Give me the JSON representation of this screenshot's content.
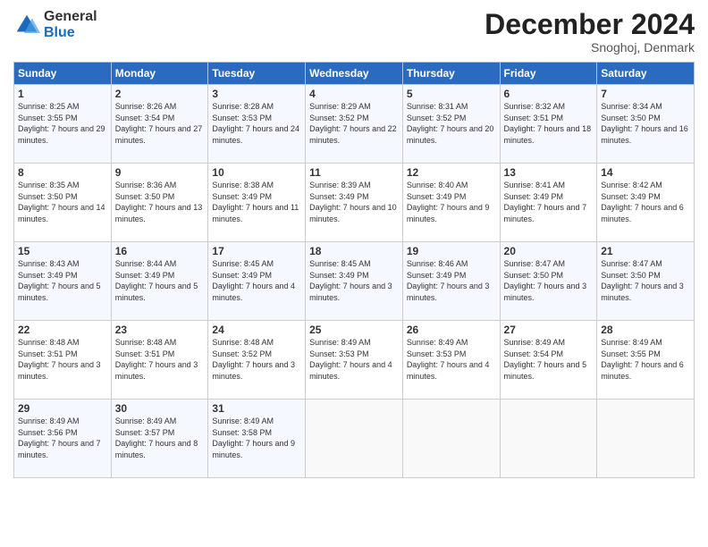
{
  "logo": {
    "general": "General",
    "blue": "Blue"
  },
  "title": "December 2024",
  "location": "Snoghoj, Denmark",
  "days_of_week": [
    "Sunday",
    "Monday",
    "Tuesday",
    "Wednesday",
    "Thursday",
    "Friday",
    "Saturday"
  ],
  "weeks": [
    [
      {
        "day": "1",
        "sunrise": "8:25 AM",
        "sunset": "3:55 PM",
        "daylight": "7 hours and 29 minutes."
      },
      {
        "day": "2",
        "sunrise": "8:26 AM",
        "sunset": "3:54 PM",
        "daylight": "7 hours and 27 minutes."
      },
      {
        "day": "3",
        "sunrise": "8:28 AM",
        "sunset": "3:53 PM",
        "daylight": "7 hours and 24 minutes."
      },
      {
        "day": "4",
        "sunrise": "8:29 AM",
        "sunset": "3:52 PM",
        "daylight": "7 hours and 22 minutes."
      },
      {
        "day": "5",
        "sunrise": "8:31 AM",
        "sunset": "3:52 PM",
        "daylight": "7 hours and 20 minutes."
      },
      {
        "day": "6",
        "sunrise": "8:32 AM",
        "sunset": "3:51 PM",
        "daylight": "7 hours and 18 minutes."
      },
      {
        "day": "7",
        "sunrise": "8:34 AM",
        "sunset": "3:50 PM",
        "daylight": "7 hours and 16 minutes."
      }
    ],
    [
      {
        "day": "8",
        "sunrise": "8:35 AM",
        "sunset": "3:50 PM",
        "daylight": "7 hours and 14 minutes."
      },
      {
        "day": "9",
        "sunrise": "8:36 AM",
        "sunset": "3:50 PM",
        "daylight": "7 hours and 13 minutes."
      },
      {
        "day": "10",
        "sunrise": "8:38 AM",
        "sunset": "3:49 PM",
        "daylight": "7 hours and 11 minutes."
      },
      {
        "day": "11",
        "sunrise": "8:39 AM",
        "sunset": "3:49 PM",
        "daylight": "7 hours and 10 minutes."
      },
      {
        "day": "12",
        "sunrise": "8:40 AM",
        "sunset": "3:49 PM",
        "daylight": "7 hours and 9 minutes."
      },
      {
        "day": "13",
        "sunrise": "8:41 AM",
        "sunset": "3:49 PM",
        "daylight": "7 hours and 7 minutes."
      },
      {
        "day": "14",
        "sunrise": "8:42 AM",
        "sunset": "3:49 PM",
        "daylight": "7 hours and 6 minutes."
      }
    ],
    [
      {
        "day": "15",
        "sunrise": "8:43 AM",
        "sunset": "3:49 PM",
        "daylight": "7 hours and 5 minutes."
      },
      {
        "day": "16",
        "sunrise": "8:44 AM",
        "sunset": "3:49 PM",
        "daylight": "7 hours and 5 minutes."
      },
      {
        "day": "17",
        "sunrise": "8:45 AM",
        "sunset": "3:49 PM",
        "daylight": "7 hours and 4 minutes."
      },
      {
        "day": "18",
        "sunrise": "8:45 AM",
        "sunset": "3:49 PM",
        "daylight": "7 hours and 3 minutes."
      },
      {
        "day": "19",
        "sunrise": "8:46 AM",
        "sunset": "3:49 PM",
        "daylight": "7 hours and 3 minutes."
      },
      {
        "day": "20",
        "sunrise": "8:47 AM",
        "sunset": "3:50 PM",
        "daylight": "7 hours and 3 minutes."
      },
      {
        "day": "21",
        "sunrise": "8:47 AM",
        "sunset": "3:50 PM",
        "daylight": "7 hours and 3 minutes."
      }
    ],
    [
      {
        "day": "22",
        "sunrise": "8:48 AM",
        "sunset": "3:51 PM",
        "daylight": "7 hours and 3 minutes."
      },
      {
        "day": "23",
        "sunrise": "8:48 AM",
        "sunset": "3:51 PM",
        "daylight": "7 hours and 3 minutes."
      },
      {
        "day": "24",
        "sunrise": "8:48 AM",
        "sunset": "3:52 PM",
        "daylight": "7 hours and 3 minutes."
      },
      {
        "day": "25",
        "sunrise": "8:49 AM",
        "sunset": "3:53 PM",
        "daylight": "7 hours and 4 minutes."
      },
      {
        "day": "26",
        "sunrise": "8:49 AM",
        "sunset": "3:53 PM",
        "daylight": "7 hours and 4 minutes."
      },
      {
        "day": "27",
        "sunrise": "8:49 AM",
        "sunset": "3:54 PM",
        "daylight": "7 hours and 5 minutes."
      },
      {
        "day": "28",
        "sunrise": "8:49 AM",
        "sunset": "3:55 PM",
        "daylight": "7 hours and 6 minutes."
      }
    ],
    [
      {
        "day": "29",
        "sunrise": "8:49 AM",
        "sunset": "3:56 PM",
        "daylight": "7 hours and 7 minutes."
      },
      {
        "day": "30",
        "sunrise": "8:49 AM",
        "sunset": "3:57 PM",
        "daylight": "7 hours and 8 minutes."
      },
      {
        "day": "31",
        "sunrise": "8:49 AM",
        "sunset": "3:58 PM",
        "daylight": "7 hours and 9 minutes."
      },
      null,
      null,
      null,
      null
    ]
  ]
}
